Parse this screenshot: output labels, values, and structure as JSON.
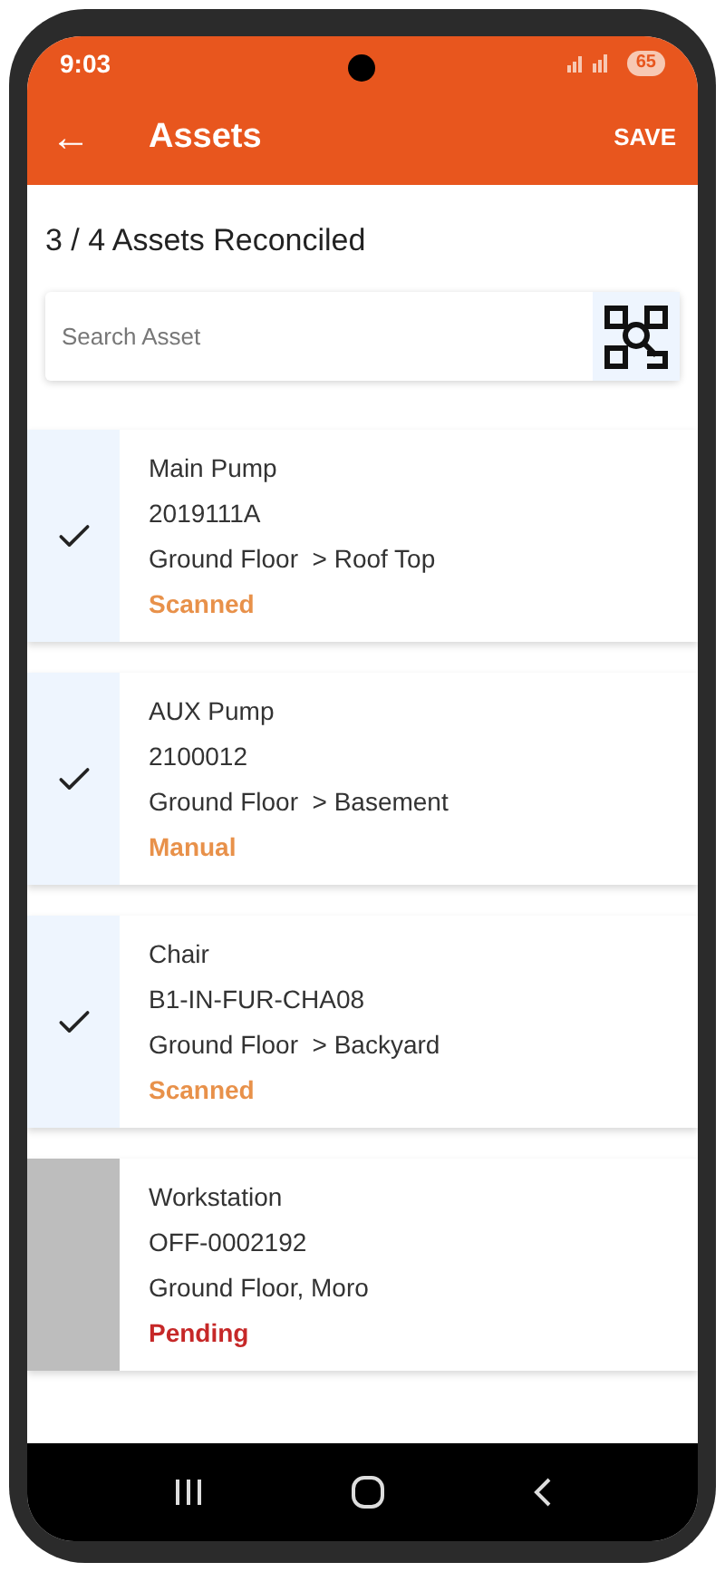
{
  "status_bar": {
    "time": "9:03",
    "battery": "65"
  },
  "app_bar": {
    "back": "←",
    "title": "Assets",
    "action": "SAVE"
  },
  "summary": "3 / 4 Assets Reconciled",
  "search": {
    "placeholder": "Search Asset"
  },
  "assets": [
    {
      "name": "Main Pump",
      "code": "2019111A",
      "location": "Ground Floor  > Roof Top",
      "reconciled": true,
      "status": {
        "label": "Scanned",
        "color": "#e8914a"
      }
    },
    {
      "name": "AUX Pump",
      "code": "2100012",
      "location": "Ground Floor  > Basement",
      "reconciled": true,
      "status": {
        "label": "Manual",
        "color": "#e8914a"
      }
    },
    {
      "name": "Chair",
      "code": "B1-IN-FUR-CHA08",
      "location": "Ground Floor  > Backyard",
      "reconciled": true,
      "status": {
        "label": "Scanned",
        "color": "#e8914a"
      }
    },
    {
      "name": "Workstation",
      "code": "OFF-0002192",
      "location": "Ground Floor, Moro",
      "reconciled": false,
      "status": {
        "label": "Pending",
        "color": "#c62828"
      }
    }
  ]
}
